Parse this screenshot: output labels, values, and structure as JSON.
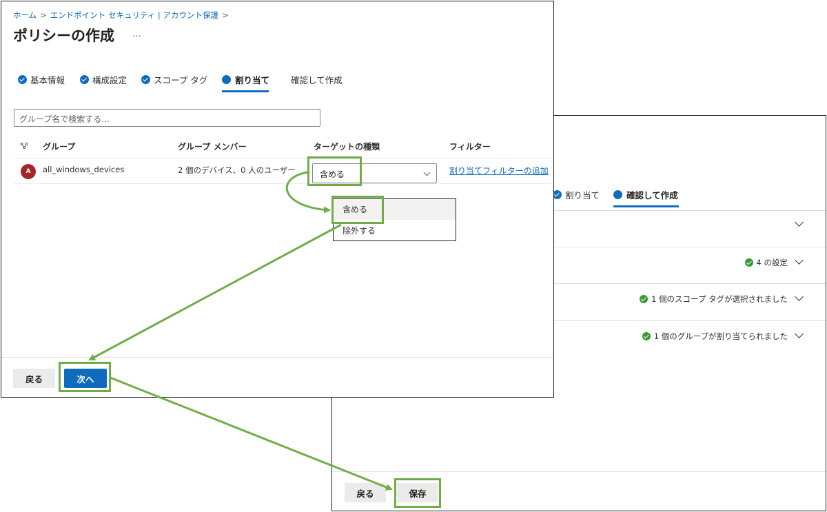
{
  "front": {
    "breadcrumb": [
      "ホーム",
      "エンドポイント セキュリティ | アカウント保護"
    ],
    "title": "ポリシーの作成",
    "more": "…",
    "steps": [
      {
        "label": "基本情報",
        "state": "done"
      },
      {
        "label": "構成設定",
        "state": "done"
      },
      {
        "label": "スコープ タグ",
        "state": "done"
      },
      {
        "label": "割り当て",
        "state": "active"
      },
      {
        "label": "確認して作成",
        "state": "pending"
      }
    ],
    "search_placeholder": "グループ名で検索する...",
    "table": {
      "headers": [
        "グループ",
        "グループ メンバー",
        "ターゲットの種類",
        "フィルター"
      ],
      "row": {
        "avatar": "A",
        "group": "all_windows_devices",
        "members": "2 個のデバイス、0 人のユーザー",
        "target": "含める",
        "filter_link": "割り当てフィルターの追加"
      }
    },
    "dropdown_options": [
      "含める",
      "除外する"
    ],
    "buttons": {
      "back": "戻る",
      "next": "次へ"
    }
  },
  "back": {
    "steps": [
      {
        "label": "割り当て",
        "state": "done"
      },
      {
        "label": "確認して作成",
        "state": "active"
      }
    ],
    "sections": [
      {
        "summary": ""
      },
      {
        "summary": "4 の設定"
      },
      {
        "summary": "1 個のスコープ タグが選択されました"
      },
      {
        "summary": "1 個のグループが割り当てられました"
      }
    ],
    "buttons": {
      "back": "戻る",
      "save": "保存"
    }
  },
  "colors": {
    "accent": "#0f6cbd",
    "highlight": "#70ad47",
    "success": "#359b35",
    "avatar": "#a4262c"
  }
}
